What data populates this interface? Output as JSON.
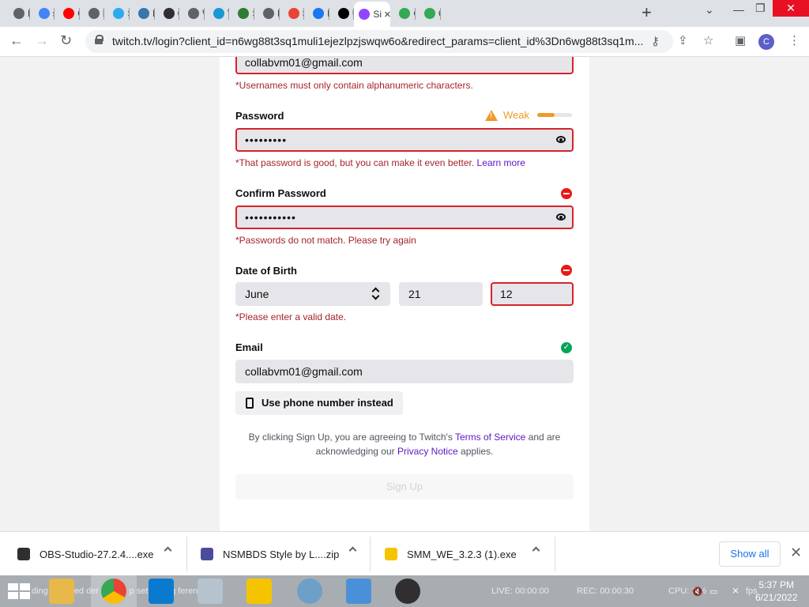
{
  "browser": {
    "tabs": [
      {
        "label": "D",
        "icon": "chrome",
        "color": "#5f6368"
      },
      {
        "label": "s",
        "icon": "google",
        "color": "#4285f4"
      },
      {
        "label": "C",
        "icon": "youtube",
        "color": "#ff0000"
      },
      {
        "label": "N",
        "icon": "github",
        "color": "#5f6368"
      },
      {
        "label": "S",
        "icon": "telegram",
        "color": "#2aabee"
      },
      {
        "label": "D",
        "icon": "python",
        "color": "#3776ab"
      },
      {
        "label": "C",
        "icon": "obs",
        "color": "#302e31"
      },
      {
        "label": "W",
        "icon": "globe",
        "color": "#5f6368"
      },
      {
        "label": "V",
        "icon": "v",
        "color": "#1a97d5"
      },
      {
        "label": "S",
        "icon": "game",
        "color": "#2e7d32"
      },
      {
        "label": "N",
        "icon": "github",
        "color": "#5f6368"
      },
      {
        "label": "S",
        "icon": "gmail",
        "color": "#ea4335"
      },
      {
        "label": "F",
        "icon": "facebook",
        "color": "#1877f2"
      },
      {
        "label": "U",
        "icon": "tiktok",
        "color": "#000000"
      }
    ],
    "active_tab": {
      "label": "Si",
      "icon": "twitch",
      "color": "#9146ff",
      "close": "×"
    },
    "trailing_tabs": [
      {
        "label": "C",
        "icon": "play",
        "color": "#34a853"
      },
      {
        "label": "C",
        "icon": "play",
        "color": "#34a853"
      }
    ],
    "new_tab": "+",
    "url": "twitch.tv/login?client_id=n6wg88t3sq1muli1ejezlpzjswqw6o&redirect_params=client_id%3Dn6wg88t3sq1m...",
    "profile_initial": "C"
  },
  "form": {
    "username_value": "collabvm01@gmail.com",
    "username_error": "*Usernames must only contain alphanumeric characters.",
    "password_label": "Password",
    "password_strength": "Weak",
    "password_strength_level": 0.5,
    "password_dots": "•••••••••",
    "password_error": "*That password is good, but you can make it even better.",
    "learn_more": "Learn more",
    "confirm_label": "Confirm Password",
    "confirm_dots": "•••••••••••",
    "confirm_error": "*Passwords do not match. Please try again",
    "dob_label": "Date of Birth",
    "dob_month": "June",
    "dob_day": "21",
    "dob_year": "12",
    "dob_error": "*Please enter a valid date.",
    "email_label": "Email",
    "email_value": "collabvm01@gmail.com",
    "phone_button": "Use phone number instead",
    "terms_pre": "By clicking Sign Up, you are agreeing to Twitch's",
    "terms_link": "Terms of Service",
    "terms_mid": "and are acknowledging our",
    "privacy_link": "Privacy Notice",
    "terms_post": "applies.",
    "signup_button": "Sign Up"
  },
  "downloads": [
    {
      "name": "OBS-Studio-27.2.4....exe",
      "icon": "obs",
      "color": "#302e31"
    },
    {
      "name": "NSMBDS Style by L....zip",
      "icon": "zip",
      "color": "#4b4b9e"
    },
    {
      "name": "SMM_WE_3.2.3 (1).exe",
      "icon": "smm",
      "color": "#f5c400"
    }
  ],
  "show_all": "Show all",
  "taskbar": {
    "ghost_text": "ding... loaded   der t   down      p setti    using   feren    presa",
    "live": "LIVE: 00:00:00",
    "rec": "REC: 00:00:30",
    "cpu": "CPU: 1.%",
    "fps": "fps",
    "time": "5:37 PM",
    "date": "6/21/2022"
  }
}
